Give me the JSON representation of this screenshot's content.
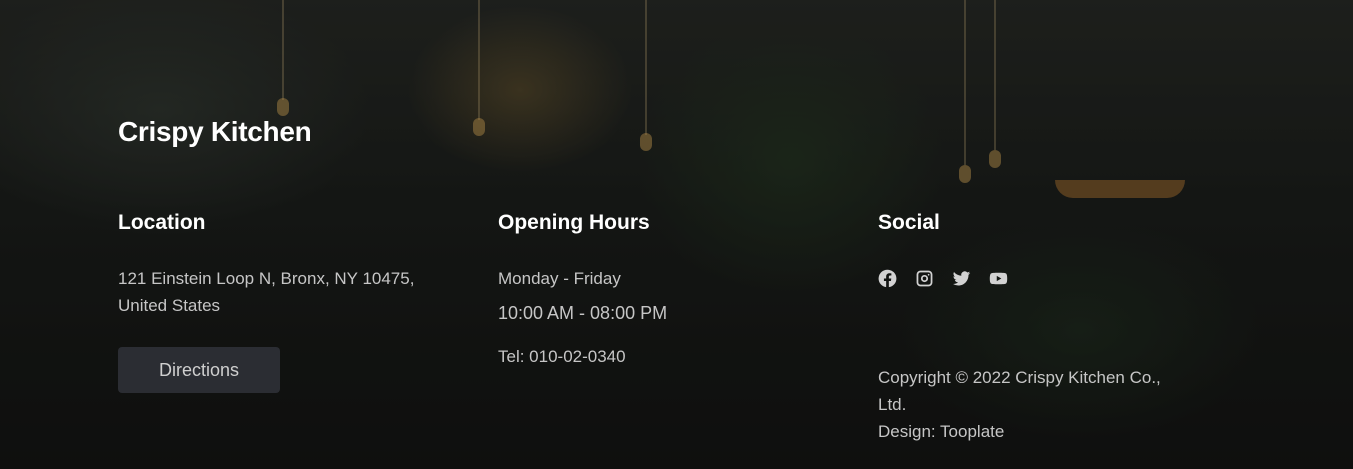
{
  "brand": {
    "name": "Crispy Kitchen"
  },
  "location": {
    "heading": "Location",
    "address_line1": "121 Einstein Loop N, Bronx, NY 10475,",
    "address_line2": "United States",
    "directions_label": "Directions"
  },
  "hours": {
    "heading": "Opening Hours",
    "days": "Monday - Friday",
    "time": "10:00 AM - 08:00 PM",
    "tel": "Tel: 010-02-0340"
  },
  "social": {
    "heading": "Social",
    "icons": [
      "facebook-icon",
      "instagram-icon",
      "twitter-icon",
      "youtube-icon"
    ],
    "copyright_line1": "Copyright © 2022 Crispy Kitchen Co.,",
    "copyright_line2": "Ltd.",
    "design_credit": "Design: Tooplate"
  },
  "colors": {
    "text": "#ffffff",
    "muted_text": "#c6c6c6",
    "button_bg": "#2b2d33"
  }
}
